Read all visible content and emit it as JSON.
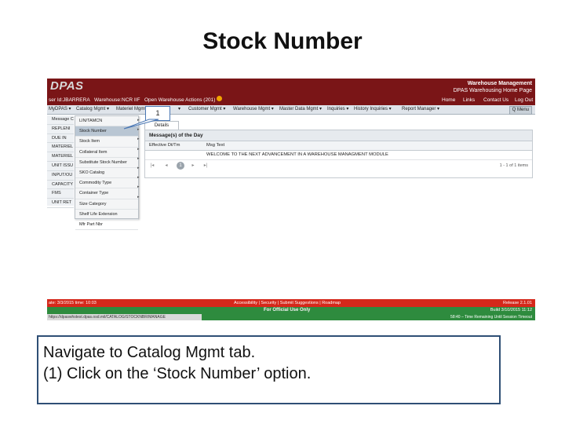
{
  "slide": {
    "title": "Stock Number",
    "caption": [
      "Navigate to Catalog Mgmt tab.",
      "(1) Click on the ‘Stock Number’ option."
    ]
  },
  "app": {
    "logo": "DPAS",
    "banner_title": "Warehouse Management",
    "banner_subtitle": "DPAS Warehousing Home Page",
    "user_label": "ser Id:",
    "user_value": "JBARRERA",
    "warehouse_label": "Warehouse:",
    "warehouse_value": "NCR IIF",
    "open_actions": "Open Warehouse Actions (201)",
    "top_links": [
      "Home",
      "Links",
      "Contact Us",
      "Log Out"
    ]
  },
  "navbar": {
    "items": [
      "MyDPAS ▾",
      "Catalog Mgmt ▾",
      "Materiel Mgmt",
      "▾",
      "Customer Mgmt ▾",
      "Warehouse Mgmt ▾",
      "Master Data Mgmt ▾",
      "Inquiries ▾",
      "History Inquiries ▾",
      "Report Manager ▾"
    ],
    "menu_button": "Q Menu"
  },
  "left_menu": [
    "Message C",
    "REPLENI",
    "DUE IN",
    "MATERIEL",
    "MATERIEL",
    "UNIT ISSU",
    "INPUT/OU",
    "CAPACITY",
    "FMS",
    "UNIT RET"
  ],
  "dropdown": {
    "items": [
      "LIN/TAMCN",
      "Stock Number",
      "Stock Item",
      "Collateral Item",
      "Substitute Stock Number",
      "SKO Catalog",
      "Commodity Type",
      "Container Type",
      "Size Category",
      "Shelf Life Extension",
      "Mfr Part Nbr"
    ],
    "highlighted_index": 1,
    "arrows": [
      "▸",
      "▸",
      "▸",
      "▸",
      "▸",
      "▸",
      "▸",
      "▸",
      "▸"
    ]
  },
  "details": {
    "tab": "Details",
    "panel_title": "Message(s) of the Day",
    "columns": [
      "Effective Dt/Tm",
      "Msg Text"
    ],
    "rows": [
      {
        "date": "",
        "text": "WELCOME TO THE NEXT ADVANCEMENT IN A WAREHOUSE MANAGMENT MODULE"
      }
    ],
    "pager": {
      "first": "|◂",
      "prev": "◂",
      "page": "1",
      "next": "▸",
      "last": "▸|",
      "info": "1 - 1 of 1 items"
    }
  },
  "callout": {
    "label": "1"
  },
  "footer": {
    "left_status": "ate: 3/3/2015 time: 10:03",
    "links": "Accessibility | Security | Submit Suggestions | Roadmap",
    "release": "Release 2.1.01",
    "official": "For Official Use Only",
    "build": "Build 3/10/2015 11:12",
    "url": "https://dpaswhstest.dpas.osd.mil/CATALOG/STOCKNBR/MANAGE",
    "session": "58:40 – Time Remaining Until Session Timeout"
  }
}
